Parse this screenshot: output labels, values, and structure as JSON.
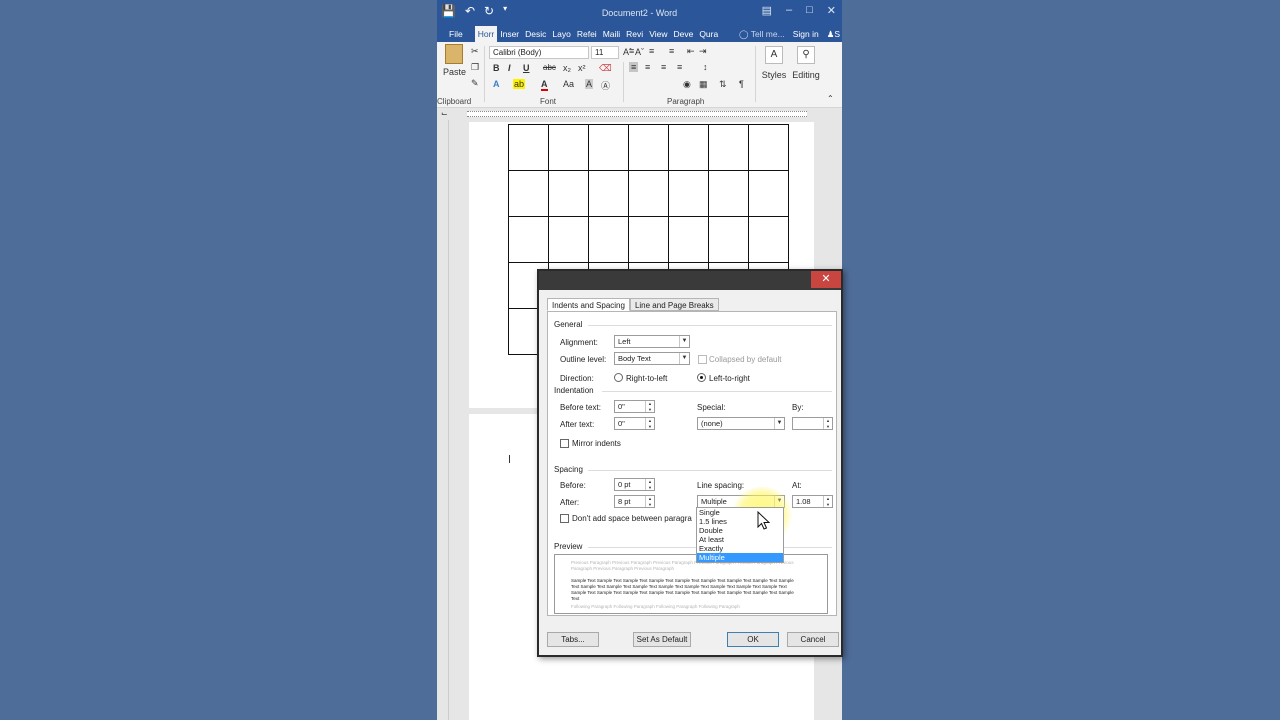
{
  "window": {
    "title": "Document2 - Word",
    "qat": {
      "save_icon": "save-icon",
      "undo_icon": "undo-icon",
      "redo_icon": "redo-icon",
      "customize_icon": "customize-qat-icon"
    },
    "controls": [
      "ribbon-options-icon",
      "minimize-icon",
      "maximize-icon",
      "close-icon"
    ]
  },
  "ribbon_tabs": {
    "file": "File",
    "items": [
      "Horr",
      "Inser",
      "Desic",
      "Layo",
      "Refei",
      "Maili",
      "Revi",
      "View",
      "Deve",
      "Qura"
    ],
    "active_index": 0,
    "tell_me": "Tell me...",
    "sign_in": "Sign in",
    "share": "S"
  },
  "ribbon": {
    "paste": "Paste",
    "font_name": "Calibri (Body)",
    "font_size": "11",
    "styles": "Styles",
    "editing": "Editing",
    "groups": {
      "clipboard": "Clipboard",
      "font": "Font",
      "paragraph": "Paragraph"
    },
    "font_buttons": [
      "B",
      "I",
      "U",
      "abc",
      "x₂",
      "x²"
    ]
  },
  "dialog": {
    "tabs": [
      "Indents and Spacing",
      "Line and Page Breaks"
    ],
    "active_tab": 0,
    "general": {
      "heading": "General",
      "alignment_label": "Alignment:",
      "alignment_value": "Left",
      "outline_label": "Outline level:",
      "outline_value": "Body Text",
      "collapsed_label": "Collapsed by default",
      "direction_label": "Direction:",
      "rtl_label": "Right-to-left",
      "ltr_label": "Left-to-right"
    },
    "indentation": {
      "heading": "Indentation",
      "before_label": "Before text:",
      "before_value": "0\"",
      "after_label": "After text:",
      "after_value": "0\"",
      "special_label": "Special:",
      "special_value": "(none)",
      "by_label": "By:",
      "by_value": "",
      "mirror_label": "Mirror indents"
    },
    "spacing": {
      "heading": "Spacing",
      "before_label": "Before:",
      "before_value": "0 pt",
      "after_label": "After:",
      "after_value": "8 pt",
      "line_spacing_label": "Line spacing:",
      "line_spacing_value": "Multiple",
      "at_label": "At:",
      "at_value": "1.08",
      "dont_add_label": "Don't add space between paragra"
    },
    "line_spacing_options": [
      "Single",
      "1.5 lines",
      "Double",
      "At least",
      "Exactly",
      "Multiple"
    ],
    "line_spacing_highlighted": 5,
    "preview": {
      "heading": "Preview",
      "prev_text": "Previous Paragraph Previous Paragraph Previous Paragraph Previous Paragraph Previous Paragraph Previous Paragraph Previous Paragraph Previous Paragraph",
      "sample_text": "Sample Text Sample Text Sample Text Sample Text Sample Text Sample Text Sample Text Sample Text Sample Text Sample Text Sample Text Sample Text Sample Text Sample Text Sample Text Sample Text Sample Text Sample Text Sample Text Sample Text Sample Text Sample Text Sample Text Sample Text Sample Text Sample Text",
      "next_text": "Following Paragraph Following Paragraph Following Paragraph Following Paragraph"
    },
    "buttons": {
      "tabs": "Tabs...",
      "set_default": "Set As Default",
      "ok": "OK",
      "cancel": "Cancel"
    }
  },
  "colors": {
    "word_blue": "#2b579a",
    "close_red": "#c94540",
    "highlight": "#3399ff"
  }
}
